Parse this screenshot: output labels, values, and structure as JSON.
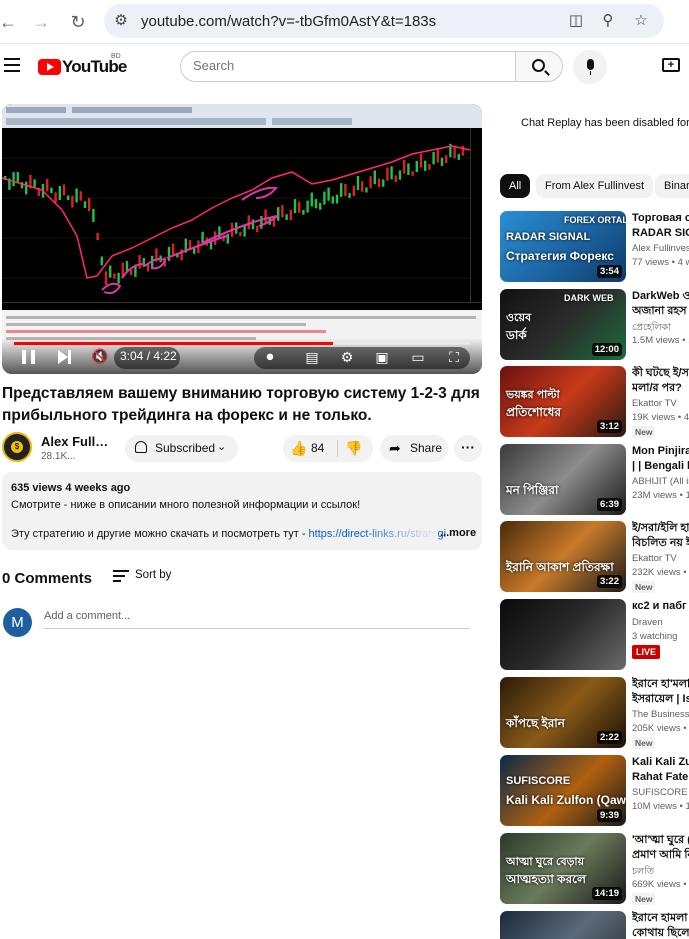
{
  "browser": {
    "url": "youtube.com/watch?v=-tbGfm0AstY&t=183s"
  },
  "header": {
    "logo_text": "YouTube",
    "region": "BD",
    "search_placeholder": "Search"
  },
  "player": {
    "current_time": "3:04",
    "duration": "4:22",
    "time_display": "3:04 / 4:22",
    "progress_fraction": 0.7
  },
  "video": {
    "title": "Представляем вашему вниманию торговую систему 1-2-3 для прибыльного трейдинга на форекс и не только.",
    "channel": "Alex Fullinvest",
    "subscribers": "28.1K...",
    "subscribe_label": "Subscribed",
    "likes": "84",
    "share_label": "Share"
  },
  "description": {
    "stats": "635 views  4 weeks ago",
    "line1": "Смотрите - ниже в описании много полезной информации и ссылок!",
    "line2": "Эту стратегию и другие можно скачать и посмотреть тут - ",
    "link": "https://direct-links.ru/strategi",
    "more": "...more"
  },
  "comments": {
    "title": "0 Comments",
    "sort_label": "Sort by",
    "avatar_letter": "M",
    "placeholder": "Add a comment..."
  },
  "sidebar": {
    "chat_replay": "Chat Replay has been disabled for this",
    "chips": [
      "All",
      "From Alex Fullinvest",
      "Binar"
    ],
    "recommendations": [
      {
        "title": "Торговая си",
        "title2": "RADAR SIGN",
        "channel": "Alex Fullinvest",
        "meta": "77 views • 4 w",
        "duration": "3:54",
        "badge": "",
        "thumb_text": "Стратегия Форекс",
        "thumb_text2": "RADAR SIGNAL",
        "thumb_text3": "FOREX ORTAL"
      },
      {
        "title": "DarkWeb ও I",
        "title2": "অজানা রহস",
        "channel": "প্রেহেলিকা",
        "meta": "1.5M views • 1",
        "duration": "12:00",
        "badge": "",
        "thumb_text": "ডার্ক",
        "thumb_text2": "ওয়েব",
        "thumb_text3": "DARK WEB"
      },
      {
        "title": "কী ঘটছে ই/স",
        "title2": "মলা/র পর?",
        "channel": "Ekattor TV",
        "meta": "19K views • 4",
        "duration": "3:12",
        "badge": "New",
        "thumb_text": "প্রতিশোধের",
        "thumb_text2": "ভয়ঙ্কর পাল্টা",
        "thumb_text3": ""
      },
      {
        "title": "Mon Pinjira",
        "title2": "| | Bengali lo",
        "channel": "ABHIJIT (All in",
        "meta": "23M views • 1",
        "duration": "6:39",
        "badge": "",
        "thumb_text": "মন পিঞ্জিরা",
        "thumb_text2": "",
        "thumb_text3": ""
      },
      {
        "title": "ই/সরা/ইলি হা",
        "title2": "বিচলিত নয় ই",
        "channel": "Ekattor TV",
        "meta": "232K views •",
        "duration": "3:22",
        "badge": "New",
        "thumb_text": "ইরানি আকাশ প্রতিরক্ষা",
        "thumb_text2": "",
        "thumb_text3": ""
      },
      {
        "title": "кс2 и пабг",
        "title2": "",
        "channel": "Draven",
        "meta": "3 watching",
        "duration": "",
        "badge": "LIVE",
        "thumb_text": "",
        "thumb_text2": "",
        "thumb_text3": ""
      },
      {
        "title": "ইরানে হা'মলা",
        "title2": "ইসরায়েল | Is",
        "channel": "The Business S",
        "meta": "205K views •",
        "duration": "2:22",
        "badge": "New",
        "thumb_text": "কাঁপছে ইরান",
        "thumb_text2": "",
        "thumb_text3": ""
      },
      {
        "title": "Kali Kali Zulf",
        "title2": "Rahat Fateh",
        "channel": "SUFISCORE",
        "meta": "10M views • 1",
        "duration": "9:39",
        "badge": "",
        "thumb_text": "Kali Kali Zulfon (Qawwali)",
        "thumb_text2": "SUFISCORE",
        "thumb_text3": ""
      },
      {
        "title": "'আ'ত্মা ঘুরে (",
        "title2": "প্রমাণ আমি নি",
        "channel": "চলতি",
        "meta": "669K views •",
        "duration": "14:19",
        "badge": "New",
        "thumb_text": "আত্মহত্যা করলে",
        "thumb_text2": "আত্মা ঘুরে বেড়ায়",
        "thumb_text3": ""
      },
      {
        "title": "ইরানে হামলা",
        "title2": "কোথায় ছিলে",
        "channel": "",
        "meta": "",
        "duration": "",
        "badge": "",
        "thumb_text": "",
        "thumb_text2": "",
        "thumb_text3": ""
      }
    ]
  },
  "colors": {
    "brand_red": "#ff0000",
    "link_blue": "#065fd4",
    "chip_active": "#0f0f0f"
  }
}
